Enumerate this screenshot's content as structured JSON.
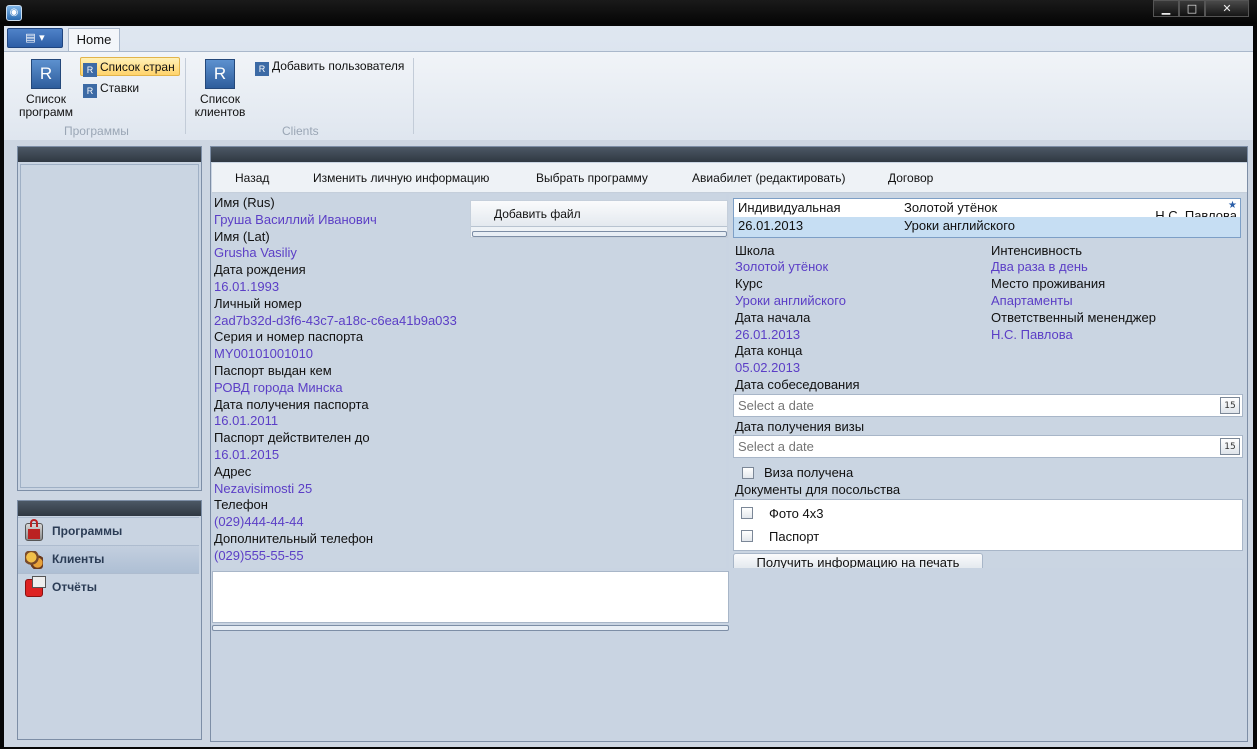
{
  "window": {
    "icon": "app-icon",
    "controls": [
      "minimize",
      "maximize",
      "close"
    ]
  },
  "ribbon": {
    "app_menu_label": "▤ ▾",
    "tab": "Home",
    "groups": [
      {
        "label": "Программы",
        "big_button": "Список программ",
        "small_buttons": [
          "Список стран",
          "Ставки"
        ]
      },
      {
        "label": "Clients",
        "big_button": "Список клиентов",
        "small_buttons": [
          "Добавить пользователя"
        ]
      }
    ],
    "icon_letter": "R",
    "highlight_color": "#ffd36b"
  },
  "nav": {
    "items": [
      {
        "label": "Программы",
        "icon": "lock-icon"
      },
      {
        "label": "Клиенты",
        "icon": "users-icon",
        "selected": true
      },
      {
        "label": "Отчёты",
        "icon": "report-icon"
      }
    ]
  },
  "toolbar": {
    "back": "Назад",
    "edit_info": "Изменить личную информацию",
    "choose_program": "Выбрать программу",
    "ticket": "Авиабилет (редактировать)",
    "contract": "Договор"
  },
  "personal": {
    "name_rus_label": "Имя (Rus)",
    "name_rus": "Груша Василлий Иванович",
    "name_lat_label": "Имя (Lat)",
    "name_lat": "Grusha Vasiliy",
    "dob_label": "Дата рождения",
    "dob": "16.01.1993",
    "id_label": "Личный номер",
    "id": "2ad7b32d-d3f6-43c7-a18c-c6ea41b9a033",
    "passport_label": "Серия и номер паспорта",
    "passport": "MY00101001010",
    "issued_by_label": "Паспорт выдан кем",
    "issued_by": "РОВД города Минска",
    "issue_date_label": "Дата получения паспорта",
    "issue_date": "16.01.2011",
    "valid_until_label": "Паспорт действителен до",
    "valid_until": "16.01.2015",
    "address_label": "Адрес",
    "address": "Nezavisimosti 25",
    "phone_label": "Телефон",
    "phone": "(029)444-44-44",
    "phone2_label": "Дополнительный телефон",
    "phone2": "(029)555-55-55"
  },
  "add_file": "Добавить файл",
  "program_row": {
    "type": "Индивидуальная",
    "school": "Золотой утёнок",
    "manager": "Н.С. Павлова",
    "date": "26.01.2013",
    "course": "Уроки английского",
    "star": "★"
  },
  "program": {
    "school_label": "Школа",
    "school": "Золотой утёнок",
    "intensity_label": "Интенсивность",
    "intensity": "Два раза в день",
    "course_label": "Курс",
    "course": "Уроки английского",
    "accom_label": "Место проживания",
    "accom": "Апартаменты",
    "start_label": "Дата начала",
    "start": "26.01.2013",
    "manager_label": "Ответственный мененджер",
    "manager": "Н.С. Павлова",
    "end_label": "Дата конца",
    "end": "05.02.2013",
    "interview_label": "Дата собеседования",
    "visa_date_label": "Дата получения визы",
    "date_placeholder": "Select a date",
    "calendar_day": "15",
    "visa_received": "Виза получена",
    "docs_label": "Документы для посольства",
    "docs": [
      "Фото 4x3",
      "Паспорт"
    ],
    "print_button": "Получить информацию на печать"
  }
}
